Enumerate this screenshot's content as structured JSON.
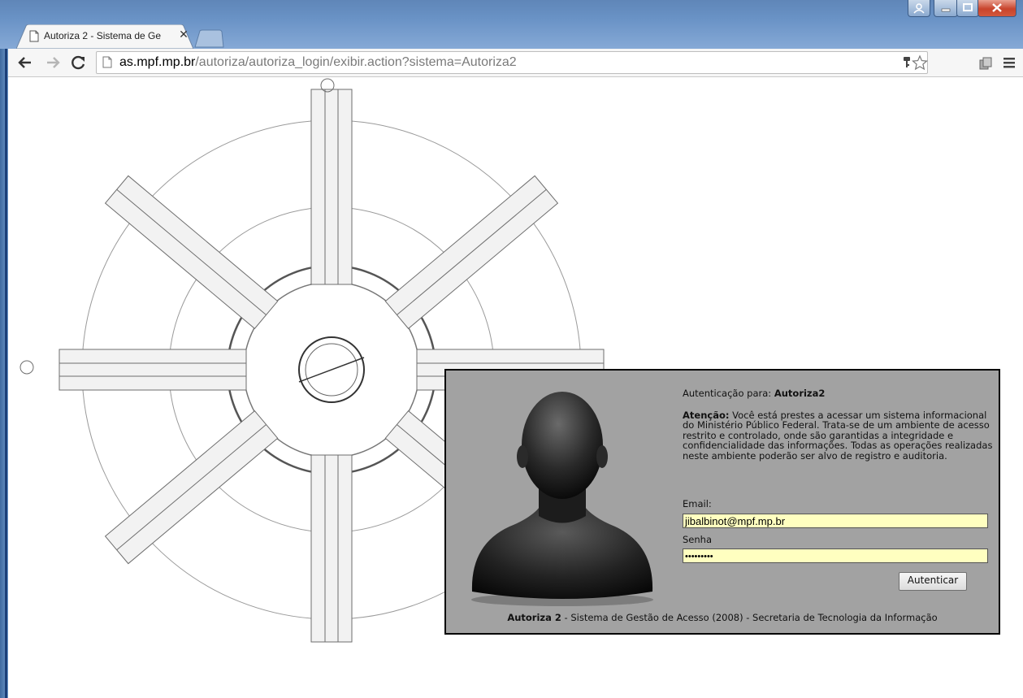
{
  "browser": {
    "tab_title": "Autoriza 2 - Sistema de Ge",
    "url_host": "as.mpf.mp.br",
    "url_path": "/autoriza/autoriza_login/exibir.action?sistema=Autoriza2",
    "icons": [
      "back-icon",
      "forward-icon",
      "reload-icon",
      "page-icon",
      "key-icon",
      "star-icon",
      "extension-icon",
      "menu-icon",
      "tab-close-icon"
    ]
  },
  "login": {
    "auth_prefix": "Autenticação para: ",
    "system_name": "Autoriza2",
    "attention_label": "Atenção:",
    "attention_text": " Você está prestes a acessar um sistema informacional do Ministério Público Federal. Trata-se de um ambiente de acesso restrito e controlado, onde são garantidas a integridade e confidencialidade das informações. Todas as operações realizadas neste ambiente poderão ser alvo de registro e auditoria.",
    "email_label": "Email:",
    "email_value": "jibalbinot@mpf.mp.br",
    "password_label": "Senha",
    "password_value": "•••••••••",
    "submit_label": "Autenticar",
    "footer_brand": "Autoriza 2",
    "footer_text": " - Sistema de Gestão de Acesso (2008) - Secretaria de Tecnologia da Informação"
  },
  "colors": {
    "panel_bg": "#a2a2a2",
    "field_bg": "#ffffc0",
    "titlebar": "#6a93c6",
    "close_button": "#c8442c"
  }
}
